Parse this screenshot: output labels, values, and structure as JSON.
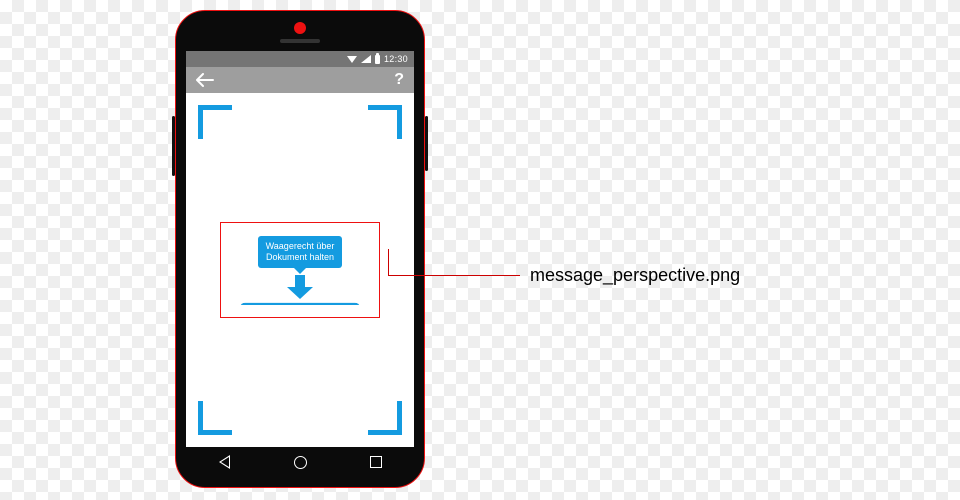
{
  "statusbar": {
    "time": "12:30"
  },
  "appbar": {
    "help_label": "?"
  },
  "message": {
    "bubble_text": "Waagerecht über\nDokument halten"
  },
  "callout": {
    "label": "message_perspective.png"
  }
}
